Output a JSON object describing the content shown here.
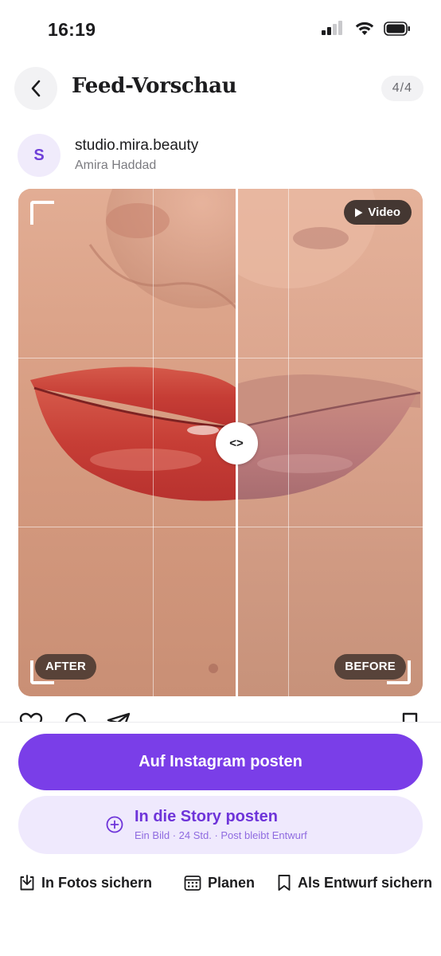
{
  "status_bar": {
    "time": "16:19"
  },
  "header": {
    "title": "Feed-Vorschau",
    "counter": "4/4"
  },
  "account": {
    "avatar_initial": "S",
    "handle": "studio.mira.beauty",
    "name": "Amira Haddad"
  },
  "media": {
    "video_badge": "Video",
    "after_label": "AFTER",
    "before_label": "BEFORE",
    "slider_glyph": "<>",
    "slider_position": 0.54
  },
  "buttons": {
    "post_instagram": "Auf Instagram posten",
    "post_story": "In die Story posten",
    "post_story_sub": "Ein Bild · 24 Std. · Post bleibt Entwurf"
  },
  "footer": {
    "save_photos": "In Fotos sichern",
    "schedule": "Planen",
    "save_draft": "Als Entwurf sichern"
  },
  "colors": {
    "accent": "#7a3ee8",
    "accent_light": "#efe9fd",
    "avatar_bg": "#f0ebfb"
  }
}
